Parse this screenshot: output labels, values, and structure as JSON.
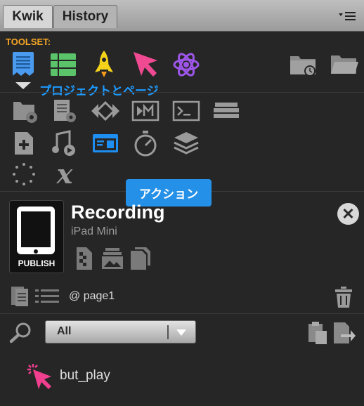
{
  "tabs": [
    {
      "label": "Kwik",
      "active": true
    },
    {
      "label": "History",
      "active": false
    }
  ],
  "menu_icon": "panel-menu-icon",
  "toolset": {
    "label": "TOOLSET:",
    "tools": [
      {
        "name": "page-tool",
        "color": "#4a9bf0"
      },
      {
        "name": "list-tool",
        "color": "#5bc46b"
      },
      {
        "name": "rocket-tool",
        "color": "#f5d31b"
      },
      {
        "name": "pointer-tool",
        "color": "#ef4a92"
      },
      {
        "name": "atom-tool",
        "color": "#9d56e8"
      }
    ]
  },
  "section": {
    "label": "プロジェクトとページ"
  },
  "tooltip": "アクション",
  "document": {
    "title": "Recording",
    "device": "iPad Mini",
    "publish_label": "PUBLISH"
  },
  "page": {
    "label": "@ page1"
  },
  "filter": {
    "selected": "All"
  },
  "actions": [
    {
      "label": "but_play",
      "icon": "pointer-icon",
      "color": "#ef3f8e"
    }
  ]
}
